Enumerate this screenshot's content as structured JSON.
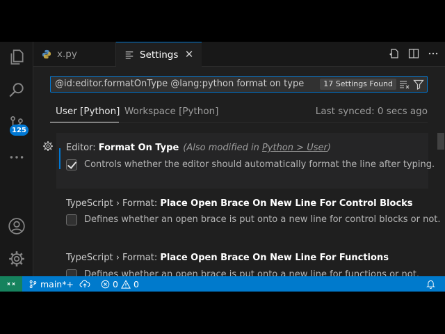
{
  "tabs": [
    {
      "label": "x.py",
      "icon": "python-icon",
      "active": false
    },
    {
      "label": "Settings",
      "icon": "settings-lines-icon",
      "active": true
    }
  ],
  "search": {
    "query": "@id:editor.formatOnType @lang:python format on type",
    "results_badge": "17 Settings Found"
  },
  "scopes": {
    "user": "User [Python]",
    "workspace": "Workspace [Python]",
    "last_synced": "Last synced: 0 secs ago"
  },
  "settings": [
    {
      "category": "Editor: ",
      "name": "Format On Type",
      "modified_prefix": "(Also modified in ",
      "modified_link": "Python > User",
      "modified_suffix": ")",
      "description": "Controls whether the editor should automatically format the line after typing.",
      "checked": true
    },
    {
      "category": "TypeScript › Format: ",
      "name": "Place Open Brace On New Line For Control Blocks",
      "description": "Defines whether an open brace is put onto a new line for control blocks or not.",
      "checked": false
    },
    {
      "category": "TypeScript › Format: ",
      "name": "Place Open Brace On New Line For Functions",
      "description": "Defines whether an open brace is put onto a new line for functions or not.",
      "checked": false
    }
  ],
  "activity_badge": "125",
  "statusbar": {
    "branch": "main*+",
    "errors": "0",
    "warnings": "0"
  },
  "colors": {
    "accent": "#0078d4",
    "statusbar": "#007acc",
    "remote": "#16825d"
  }
}
